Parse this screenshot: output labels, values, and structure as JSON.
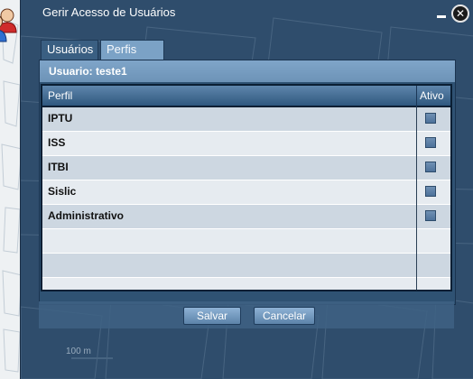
{
  "window": {
    "title": "Gerir Acesso de Usuários",
    "minimize_icon": "minimize-icon",
    "close_icon": "close-icon"
  },
  "tabs": [
    {
      "label": "Usuários",
      "active": false
    },
    {
      "label": "Perfis",
      "active": true
    }
  ],
  "panel": {
    "header": "Usuario: teste1"
  },
  "grid": {
    "columns": [
      "Perfil",
      "Ativo"
    ],
    "rows": [
      {
        "perfil": "IPTU",
        "ativo": false
      },
      {
        "perfil": "ISS",
        "ativo": false
      },
      {
        "perfil": "ITBI",
        "ativo": false
      },
      {
        "perfil": "Sislic",
        "ativo": false
      },
      {
        "perfil": "Administrativo",
        "ativo": false
      }
    ],
    "empty_rows": 3
  },
  "buttons": {
    "save": "Salvar",
    "cancel": "Cancelar"
  },
  "map": {
    "scale_label": "100 m"
  },
  "colors": {
    "window_bg": "#2f4d6c",
    "tab_active": "#7ba2c6",
    "header_bar": "#7fa5c9"
  }
}
